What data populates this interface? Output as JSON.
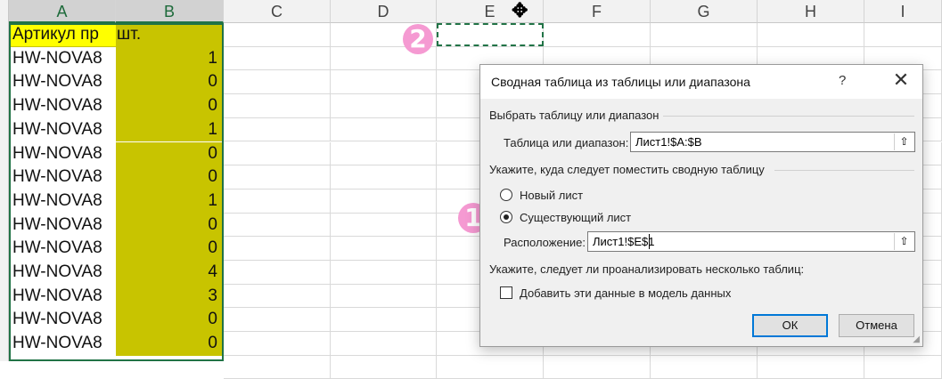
{
  "sheet": {
    "columns": [
      "A",
      "B",
      "C",
      "D",
      "E",
      "F",
      "G",
      "H",
      "I"
    ],
    "rows": [
      {
        "a": "Артикул пр",
        "b": "шт."
      },
      {
        "a": "HW-NOVA8",
        "b": "1"
      },
      {
        "a": "HW-NOVA8",
        "b": "0"
      },
      {
        "a": "HW-NOVA8",
        "b": "0"
      },
      {
        "a": "HW-NOVA8",
        "b": "1"
      },
      {
        "a": "HW-NOVA8",
        "b": "0"
      },
      {
        "a": "HW-NOVA8",
        "b": "0"
      },
      {
        "a": "HW-NOVA8",
        "b": "1"
      },
      {
        "a": "HW-NOVA8",
        "b": "0"
      },
      {
        "a": "HW-NOVA8",
        "b": "0"
      },
      {
        "a": "HW-NOVA8",
        "b": "4"
      },
      {
        "a": "HW-NOVA8",
        "b": "3"
      },
      {
        "a": "HW-NOVA8",
        "b": "0"
      },
      {
        "a": "HW-NOVA8",
        "b": "0"
      }
    ],
    "colors": {
      "selected_fill": "#c8c400",
      "header_fill": "#ffff00",
      "selection_border": "#217346"
    }
  },
  "badges": {
    "one": "1",
    "two": "2"
  },
  "dialog": {
    "title": "Сводная таблица из таблицы или диапазона",
    "help": "?",
    "close": "✕",
    "section1": "Выбрать таблицу или диапазон",
    "range_label": "Таблица или диапазон:",
    "range_value": "Лист1!$A:$B",
    "section2": "Укажите, куда следует поместить сводную таблицу",
    "new_sheet": "Новый лист",
    "existing_sheet": "Существующий лист",
    "location_label": "Расположение:",
    "location_value": "Лист1!$E$1",
    "section3": "Укажите, следует ли проанализировать несколько таблиц:",
    "add_model": "Добавить эти данные в модель данных",
    "ok": "ОК",
    "cancel": "Отмена",
    "collapse_icon": "⇧"
  }
}
